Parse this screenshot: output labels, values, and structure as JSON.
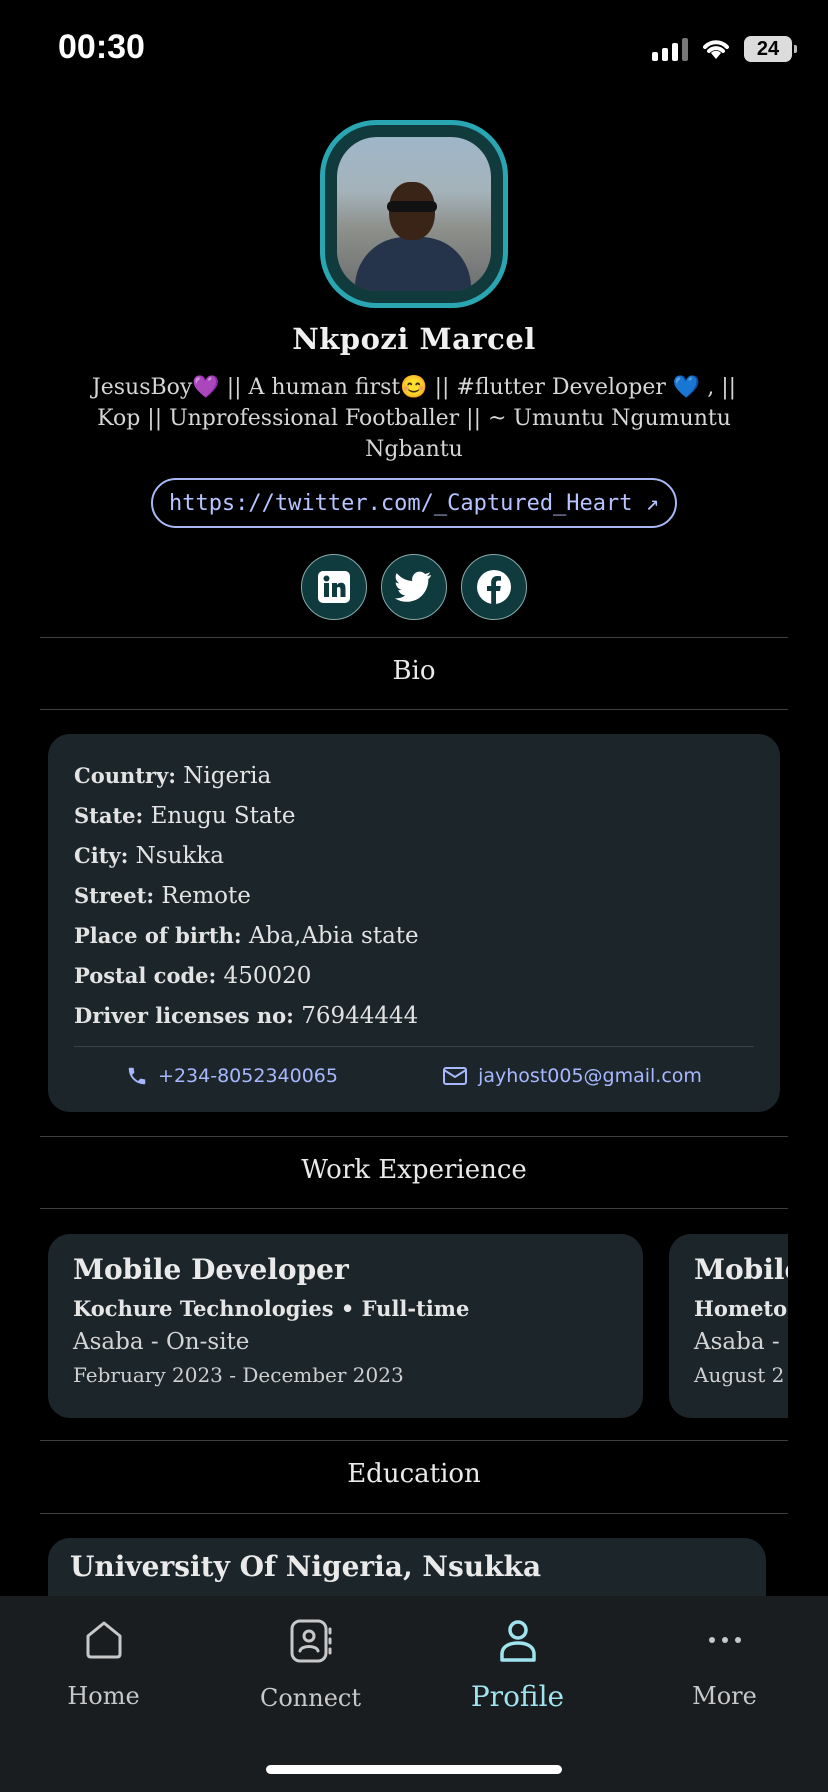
{
  "status_bar": {
    "time": "00:30",
    "battery": "24"
  },
  "profile": {
    "name": "Nkpozi Marcel",
    "bio": "JesusBoy💜 || A human first😊 || #flutter Developer 💙 , || Kop || Unprofessional Footballer || ~ Umuntu Ngumuntu Ngbantu",
    "link": "https://twitter.com/_Captured_Heart ↗"
  },
  "social": [
    "linkedin-icon",
    "twitter-icon",
    "facebook-icon"
  ],
  "sections": {
    "bio": "Bio",
    "work": "Work Experience",
    "education": "Education"
  },
  "bio_details": [
    {
      "label": "Country:",
      "value": " Nigeria"
    },
    {
      "label": "State:",
      "value": " Enugu State"
    },
    {
      "label": "City:",
      "value": " Nsukka"
    },
    {
      "label": "Street:",
      "value": " Remote"
    },
    {
      "label": "Place of birth:",
      "value": " Aba,Abia state"
    },
    {
      "label": "Postal code:",
      "value": " 450020"
    },
    {
      "label": "Driver licenses no:",
      "value": " 76944444"
    }
  ],
  "contacts": {
    "phone": "+234-8052340065",
    "email": "jayhost005@gmail.com"
  },
  "work": [
    {
      "title": "Mobile Developer",
      "company": "Kochure Technologies",
      "type": " • Full-time",
      "location": "Asaba - On-site",
      "dates": "February 2023 - December 2023"
    },
    {
      "title": "Mobile",
      "company": "Hometo",
      "type": "",
      "location": "Asaba -",
      "dates": "August 2"
    }
  ],
  "education": [
    {
      "school": "University Of Nigeria, Nsukka"
    }
  ],
  "tabs": [
    {
      "label": "Home",
      "icon": "home-icon"
    },
    {
      "label": "Connect",
      "icon": "contacts-icon"
    },
    {
      "label": "Profile",
      "icon": "person-icon"
    },
    {
      "label": "More",
      "icon": "more-icon"
    }
  ],
  "colors": {
    "accent": "#2aa6b2",
    "link": "#b7c4ff",
    "card": "#1c262a",
    "active_tab": "#9fe3ef"
  }
}
